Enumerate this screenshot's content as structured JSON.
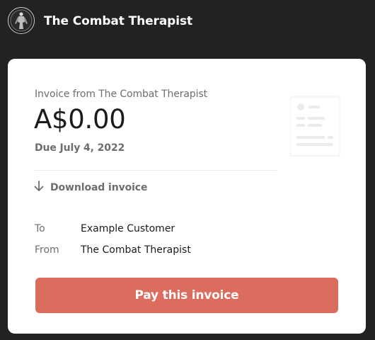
{
  "header": {
    "brand_name": "The Combat Therapist"
  },
  "invoice": {
    "summary_label": "Invoice from The Combat Therapist",
    "amount": "A$0.00",
    "due_date": "Due July 4, 2022",
    "download_label": "Download invoice",
    "details": {
      "to_label": "To",
      "to_value": "Example Customer",
      "from_label": "From",
      "from_value": "The Combat Therapist"
    },
    "pay_button_label": "Pay this invoice"
  },
  "colors": {
    "page_background": "#222222",
    "card_background": "#ffffff",
    "accent_button": "#dc6c5e",
    "muted_text": "#6e6e6e",
    "primary_text": "#1b1b1b"
  },
  "icons": {
    "logo": "combat-therapist-logo",
    "download": "arrow-down-icon",
    "document": "invoice-document-icon"
  }
}
